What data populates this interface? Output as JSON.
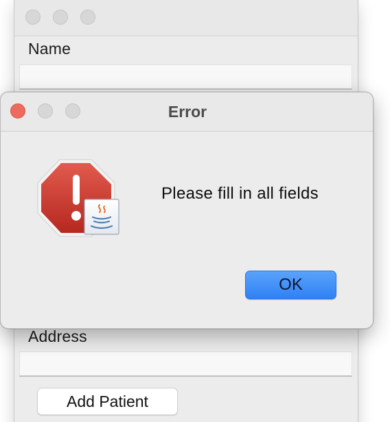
{
  "background_window": {
    "name_label": "Name",
    "name_value": "",
    "address_label": "Address",
    "address_value": "",
    "add_patient_label": "Add Patient"
  },
  "dialog": {
    "title": "Error",
    "message": "Please fill in all fields",
    "ok_label": "OK",
    "icon": "error-stop-sign-icon",
    "badge_icon": "java-app-icon"
  },
  "colors": {
    "close_button": "#ec6a5e",
    "ok_button": "#3b8cf7",
    "stop_sign": "#c8372d"
  }
}
